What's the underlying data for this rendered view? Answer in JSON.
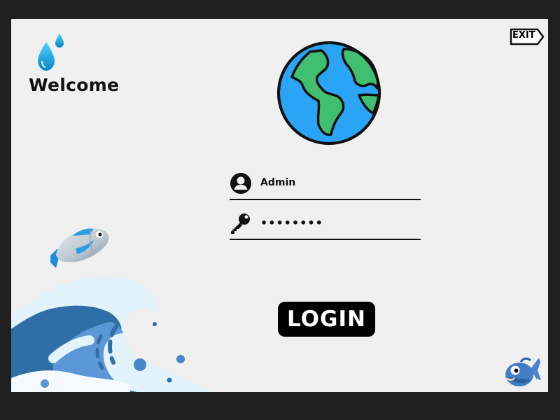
{
  "welcome": {
    "title": "Welcome"
  },
  "exit": {
    "label": "EXIT"
  },
  "login_form": {
    "username": {
      "value": "Admin"
    },
    "password": {
      "value": "••••••••"
    },
    "submit_label": "LOGIN"
  },
  "icons": {
    "drops": "water-drops-icon",
    "exit": "exit-icon",
    "globe": "globe-icon",
    "user": "user-icon",
    "key": "key-icon",
    "fish": "fish-icon",
    "wave": "wave-icon",
    "fish_mascot": "fish-mascot-icon"
  },
  "colors": {
    "background": "#f0f0f0",
    "frame": "#202020",
    "ocean": "#2aa4f4",
    "land": "#3fbf6f",
    "login_bg": "#000000"
  }
}
